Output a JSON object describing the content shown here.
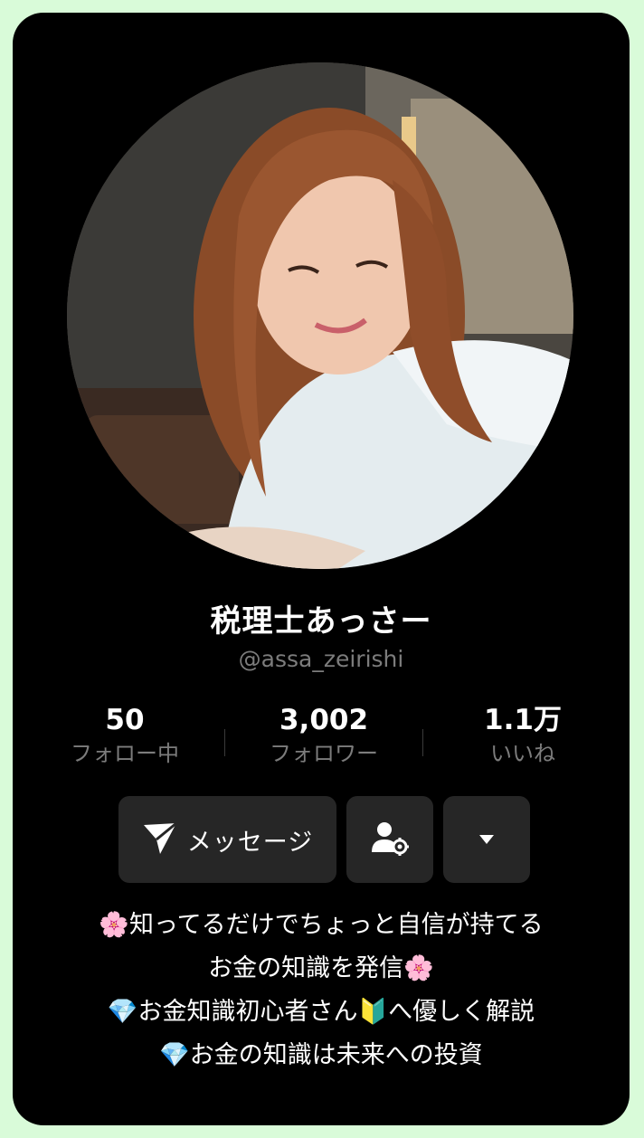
{
  "profile": {
    "display_name": "税理士あっさー",
    "username": "@assa_zeirishi"
  },
  "stats": [
    {
      "value": "50",
      "label": "フォロー中"
    },
    {
      "value": "3,002",
      "label": "フォロワー"
    },
    {
      "value": "1.1万",
      "label": "いいね"
    }
  ],
  "actions": {
    "message_label": "メッセージ",
    "message_icon": "send-icon",
    "settings_icon": "user-gear-icon",
    "more_icon": "caret-down-icon"
  },
  "bio": [
    "🌸知ってるだけでちょっと自信が持てる",
    "お金の知識を発信🌸",
    "💎お金知識初心者さん🔰へ優しく解説",
    "💎お金の知識は未来への投資"
  ],
  "colors": {
    "outer_frame": "#d9fbd9",
    "card_background": "#000000",
    "button_background": "#262626",
    "muted_text": "#7c7c7c"
  }
}
